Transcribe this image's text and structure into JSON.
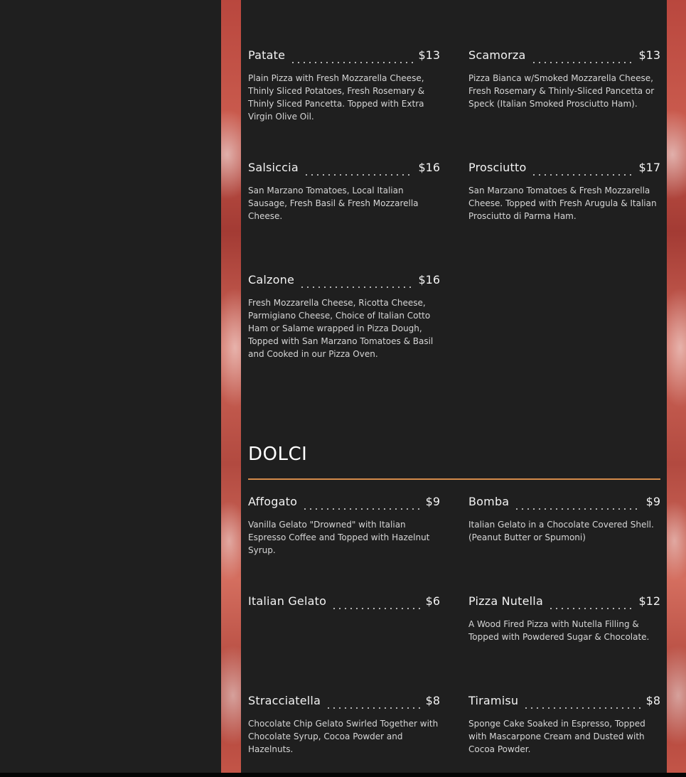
{
  "pizza_items": [
    {
      "name": "Patate",
      "price": "$13",
      "desc": "Plain Pizza with Fresh Mozzarella Cheese, Thinly Sliced Potatoes, Fresh Rosemary & Thinly Sliced Pancetta. Topped with Extra Virgin Olive Oil."
    },
    {
      "name": "Scamorza",
      "price": "$13",
      "desc": "Pizza Bianca w/Smoked Mozzarella Cheese, Fresh Rosemary & Thinly-Sliced Pancetta or Speck (Italian Smoked Prosciutto Ham)."
    },
    {
      "name": "Salsiccia",
      "price": "$16",
      "desc": "San Marzano Tomatoes, Local Italian Sausage, Fresh Basil & Fresh Mozzarella Cheese."
    },
    {
      "name": "Prosciutto",
      "price": "$17",
      "desc": "San Marzano Tomatoes & Fresh Mozzarella Cheese. Topped with Fresh Arugula & Italian Prosciutto di Parma Ham."
    },
    {
      "name": "Calzone",
      "price": "$16",
      "desc": "Fresh Mozzarella Cheese, Ricotta Cheese, Parmigiano Cheese, Choice of Italian Cotto Ham or Salame wrapped in Pizza Dough, Topped with San Marzano Tomatoes & Basil and Cooked in our Pizza Oven."
    }
  ],
  "dolci": {
    "title": "DOLCI",
    "items": [
      {
        "name": "Affogato",
        "price": "$9",
        "desc": "Vanilla Gelato \"Drowned\" with Italian Espresso Coffee and Topped with Hazelnut Syrup."
      },
      {
        "name": "Bomba",
        "price": "$9",
        "desc": "Italian Gelato in a Chocolate Covered Shell. (Peanut Butter or Spumoni)"
      },
      {
        "name": "Italian Gelato",
        "price": "$6",
        "desc": ""
      },
      {
        "name": "Pizza Nutella",
        "price": "$12",
        "desc": "A Wood Fired Pizza with Nutella Filling & Topped with Powdered Sugar & Chocolate."
      },
      {
        "name": "Stracciatella",
        "price": "$8",
        "desc": "Chocolate Chip Gelato Swirled Together with Chocolate Syrup, Cocoa Powder and Hazelnuts."
      },
      {
        "name": "Tiramisu",
        "price": "$8",
        "desc": "Sponge Cake Soaked in Espresso, Topped with Mascarpone Cream and Dusted with Cocoa Powder."
      }
    ]
  },
  "colors": {
    "accent": "#d48b4a",
    "background": "#1f1f1f",
    "text": "#ffffff"
  }
}
